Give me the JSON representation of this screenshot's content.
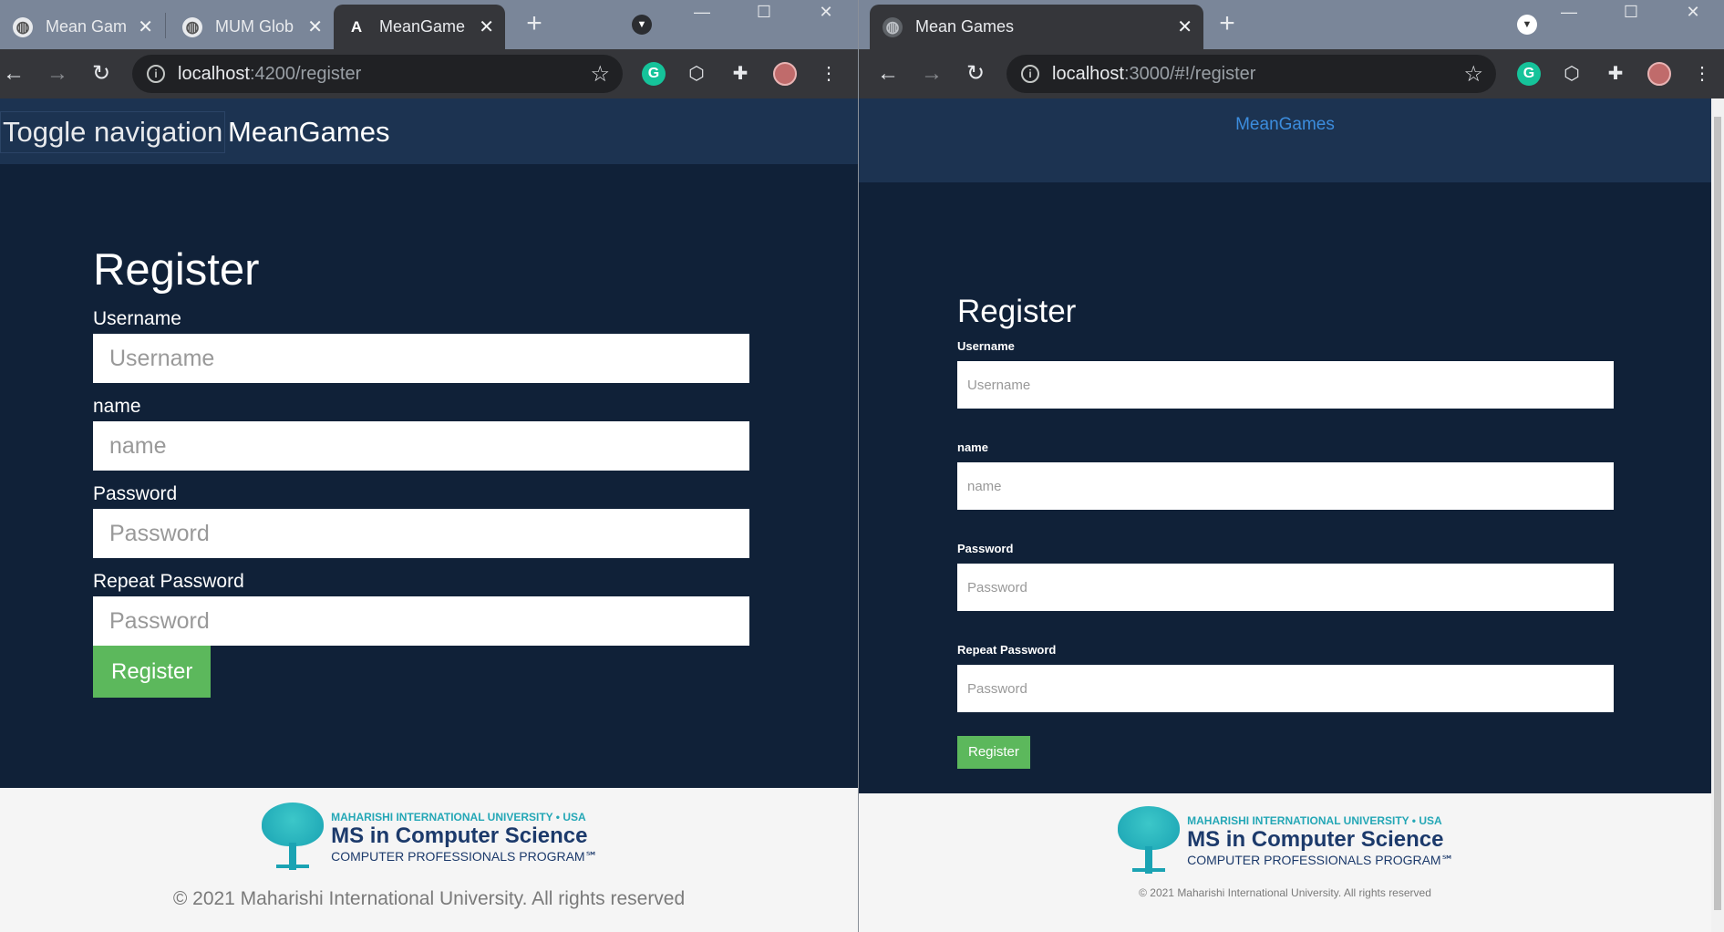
{
  "left": {
    "tabs": [
      {
        "title": "Mean Gam",
        "favicon": "globe-icon"
      },
      {
        "title": "MUM Glob",
        "favicon": "globe-icon"
      },
      {
        "title": "MeanGame",
        "favicon": "angular-icon"
      }
    ],
    "address": {
      "host": "localhost",
      "path": ":4200/register"
    },
    "navbar": {
      "toggle_label": "Toggle navigation",
      "brand": "MeanGames"
    },
    "form": {
      "title": "Register",
      "fields": [
        {
          "label": "Username",
          "placeholder": "Username"
        },
        {
          "label": "name",
          "placeholder": "name"
        },
        {
          "label": "Password",
          "placeholder": "Password"
        },
        {
          "label": "Repeat Password",
          "placeholder": "Password"
        }
      ],
      "submit_label": "Register"
    }
  },
  "right": {
    "tabs": [
      {
        "title": "Mean Games",
        "favicon": "globe-icon"
      }
    ],
    "address": {
      "host": "localhost",
      "path": ":3000/#!/register"
    },
    "navbar": {
      "brand": "MeanGames"
    },
    "form": {
      "title": "Register",
      "fields": [
        {
          "label": "Username",
          "placeholder": "Username"
        },
        {
          "label": "name",
          "placeholder": "name"
        },
        {
          "label": "Password",
          "placeholder": "Password"
        },
        {
          "label": "Repeat Password",
          "placeholder": "Password"
        }
      ],
      "submit_label": "Register"
    }
  },
  "footer": {
    "university": "MAHARISHI INTERNATIONAL UNIVERSITY • USA",
    "program_title": "MS in Computer Science",
    "program_sub": "COMPUTER PROFESSIONALS PROGRAM℠",
    "copyright": "© 2021 Maharishi International University. All rights reserved"
  },
  "colors": {
    "page_bg": "#102138",
    "navbar_bg": "#1c3351",
    "button": "#5cb85c",
    "brand_link": "#3c8dde"
  }
}
